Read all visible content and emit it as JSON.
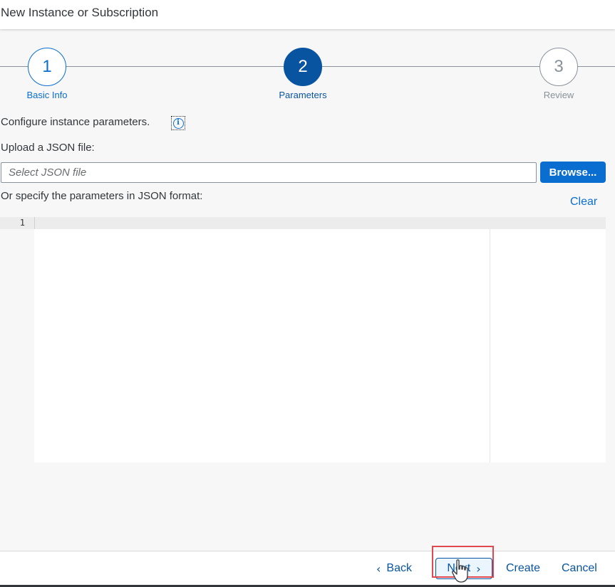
{
  "dialog": {
    "title": "New Instance or Subscription"
  },
  "wizard": {
    "steps": [
      {
        "number": "1",
        "label": "Basic Info",
        "state": "completed"
      },
      {
        "number": "2",
        "label": "Parameters",
        "state": "current"
      },
      {
        "number": "3",
        "label": "Review",
        "state": "upcoming"
      }
    ]
  },
  "parameters": {
    "configure_text": "Configure instance parameters.",
    "info_icon": "info-icon",
    "upload_label": "Upload a JSON file:",
    "file_placeholder": "Select JSON file",
    "browse_label": "Browse...",
    "specify_label": "Or specify the parameters in JSON format:",
    "clear_label": "Clear"
  },
  "editor": {
    "line_numbers": [
      "1"
    ],
    "content": ""
  },
  "footer": {
    "back_label": "Back",
    "next_label": "Next",
    "create_label": "Create",
    "cancel_label": "Cancel"
  },
  "colors": {
    "accent": "#0a6ed1",
    "accent_dark": "#0854a0",
    "highlight": "#e34850",
    "text": "#32363a",
    "inactive": "#89919a"
  }
}
